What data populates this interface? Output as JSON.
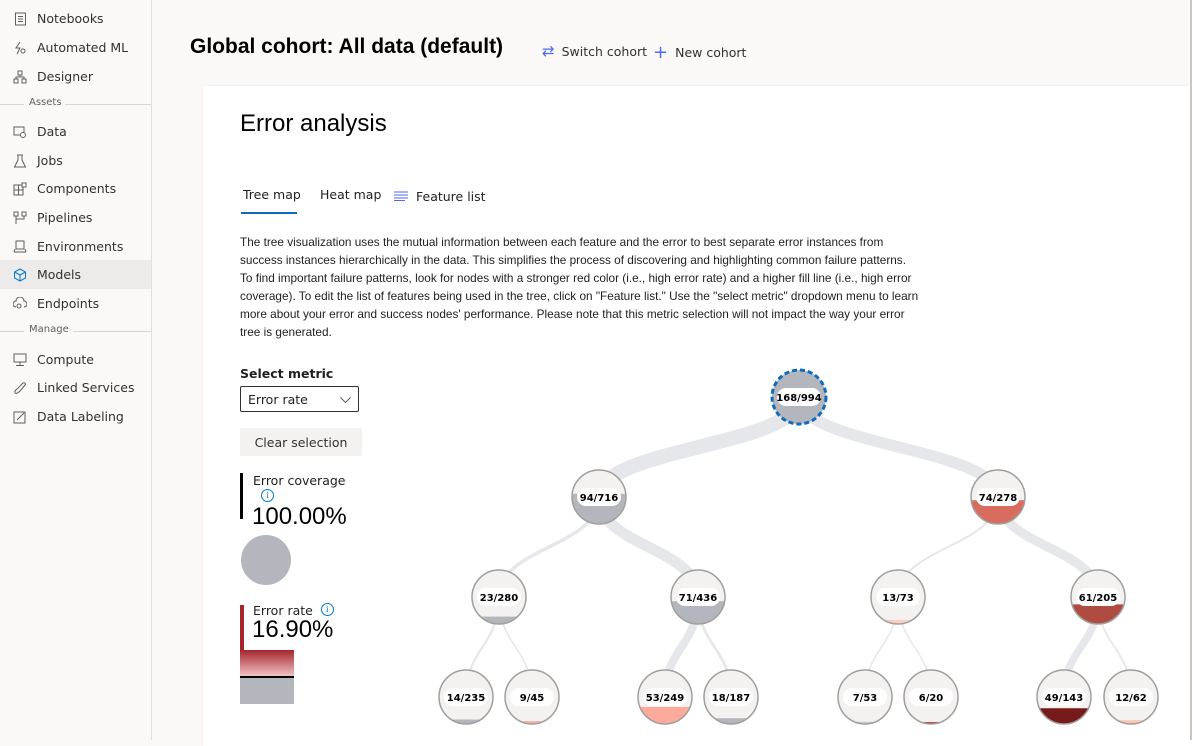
{
  "sidebar": {
    "items": [
      {
        "label": "Notebooks",
        "icon": "notebook-icon"
      },
      {
        "label": "Automated ML",
        "icon": "automl-icon"
      },
      {
        "label": "Designer",
        "icon": "designer-icon"
      },
      {
        "label": "Data",
        "icon": "data-icon"
      },
      {
        "label": "Jobs",
        "icon": "flask-icon"
      },
      {
        "label": "Components",
        "icon": "components-icon"
      },
      {
        "label": "Pipelines",
        "icon": "pipeline-icon"
      },
      {
        "label": "Environments",
        "icon": "environment-icon"
      },
      {
        "label": "Models",
        "icon": "cube-icon",
        "active": true
      },
      {
        "label": "Endpoints",
        "icon": "endpoint-icon"
      },
      {
        "label": "Compute",
        "icon": "monitor-icon"
      },
      {
        "label": "Linked Services",
        "icon": "link-icon"
      },
      {
        "label": "Data Labeling",
        "icon": "edit-icon"
      }
    ],
    "sections": {
      "assets": "Assets",
      "manage": "Manage"
    }
  },
  "header": {
    "cohort_title": "Global cohort: All data (default)",
    "switch_cohort": "Switch cohort",
    "new_cohort": "New cohort"
  },
  "card": {
    "title": "Error analysis",
    "tabs": {
      "tree_map": "Tree map",
      "heat_map": "Heat map",
      "feature_list": "Feature list"
    },
    "active_tab": "Tree map",
    "description": "The tree visualization uses the mutual information between each feature and the error to best separate error instances from success instances hierarchically in the data. This simplifies the process of discovering and highlighting common failure patterns. To find important failure patterns, look for nodes with a stronger red color (i.e., high error rate) and a higher fill line (i.e., high error coverage). To edit the list of features being used in the tree, click on \"Feature list.\" Use the \"select metric\" dropdown menu to learn more about your error and success nodes' performance. Please note that this metric selection will not impact the way your error tree is generated.",
    "select_metric_label": "Select metric",
    "select_metric_value": "Error rate",
    "clear_selection": "Clear selection",
    "error_coverage_label": "Error coverage",
    "error_coverage_value": "100.00%",
    "error_rate_label": "Error rate",
    "error_rate_value": "16.90%"
  },
  "tree": {
    "nodes": [
      {
        "id": "n0",
        "label": "168/994",
        "errors": 168,
        "total": 994,
        "fill": "#b3b6bc",
        "selected": true
      },
      {
        "id": "n1",
        "label": "94/716",
        "errors": 94,
        "total": 716,
        "fill": "#b3b6bc",
        "parent": "n0"
      },
      {
        "id": "n2",
        "label": "74/278",
        "errors": 74,
        "total": 278,
        "fill": "#d86c5e",
        "parent": "n0"
      },
      {
        "id": "n3",
        "label": "23/280",
        "errors": 23,
        "total": 280,
        "fill": "#b3b6bc",
        "parent": "n1"
      },
      {
        "id": "n4",
        "label": "71/436",
        "errors": 71,
        "total": 436,
        "fill": "#b3b6bc",
        "parent": "n1"
      },
      {
        "id": "n5",
        "label": "13/73",
        "errors": 13,
        "total": 73,
        "fill": "#fcd0c0",
        "parent": "n2"
      },
      {
        "id": "n6",
        "label": "61/205",
        "errors": 61,
        "total": 205,
        "fill": "#ae4c41",
        "parent": "n2"
      },
      {
        "id": "n7",
        "label": "14/235",
        "errors": 14,
        "total": 235,
        "fill": "#b3b6bc",
        "parent": "n3"
      },
      {
        "id": "n8",
        "label": "9/45",
        "errors": 9,
        "total": 45,
        "fill": "#f8b2a4",
        "parent": "n3"
      },
      {
        "id": "n9",
        "label": "53/249",
        "errors": 53,
        "total": 249,
        "fill": "#fcaa9b",
        "parent": "n4"
      },
      {
        "id": "n10",
        "label": "18/187",
        "errors": 18,
        "total": 187,
        "fill": "#b3b6bc",
        "parent": "n4"
      },
      {
        "id": "n11",
        "label": "7/53",
        "errors": 7,
        "total": 53,
        "fill": "#c9c9d4",
        "parent": "n5"
      },
      {
        "id": "n12",
        "label": "6/20",
        "errors": 6,
        "total": 20,
        "fill": "#b1453c",
        "parent": "n5"
      },
      {
        "id": "n13",
        "label": "49/143",
        "errors": 49,
        "total": 143,
        "fill": "#761a1a",
        "parent": "n6"
      },
      {
        "id": "n14",
        "label": "12/62",
        "errors": 12,
        "total": 62,
        "fill": "#fbc6b6",
        "parent": "n6"
      }
    ],
    "total_errors": 168
  }
}
